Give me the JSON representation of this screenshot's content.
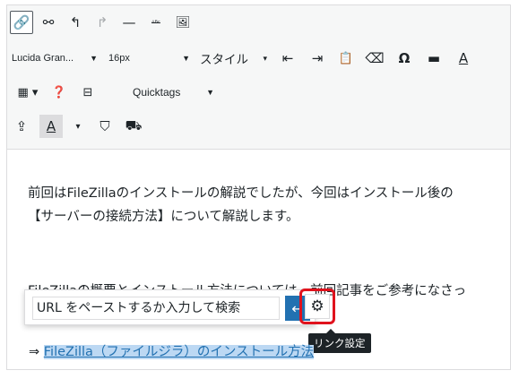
{
  "toolbar": {
    "row1": [
      {
        "name": "link-icon",
        "glyph": "🔗"
      },
      {
        "name": "unlink-icon",
        "glyph": "⚯"
      },
      {
        "name": "undo-icon",
        "glyph": "↰"
      },
      {
        "name": "redo-icon",
        "glyph": "↱"
      },
      {
        "name": "horizontal-line-icon",
        "glyph": "—"
      },
      {
        "name": "strikethrough-icon",
        "glyph": "ᴬᴮᶜ"
      },
      {
        "name": "insert-image-icon",
        "glyph": "🖼"
      }
    ],
    "font_family": "Lucida Gran...",
    "font_size": "16px",
    "styles_label": "スタイル",
    "row2_icons": [
      "decrease-indent-icon",
      "increase-indent-icon",
      "paste-text-icon",
      "clear-formatting-icon",
      "special-character-icon",
      "more-tag-icon",
      "text-color-icon"
    ],
    "row2_glyphs": [
      "⇤",
      "⇥",
      "📋",
      "⌫",
      "Ω",
      "▬",
      "A"
    ],
    "quicktags_label": "Quicktags",
    "row3_glyphs": [
      "▦ ▾",
      "❓",
      "⊟"
    ],
    "row4_glyphs": [
      "⇪",
      "A",
      "▾",
      "⛉",
      "⛟"
    ]
  },
  "content": {
    "para1_line1": "前回はFileZillaのインストールの解説でしたが、今回はインストール後の",
    "para1_line2": "【サーバーの接続方法】について解説します。",
    "para2_line1": "FileZillaの概要とインストール方法については、前回記事をご参考になさっ",
    "link_prefix": "⇒ ",
    "link_text": "FileZilla（ファイルジラ）のインストール方法"
  },
  "link_popup": {
    "placeholder": "URL をペーストするか入力して検索",
    "apply_glyph": "↵",
    "settings_glyph": "⚙",
    "tooltip": "リンク設定"
  }
}
